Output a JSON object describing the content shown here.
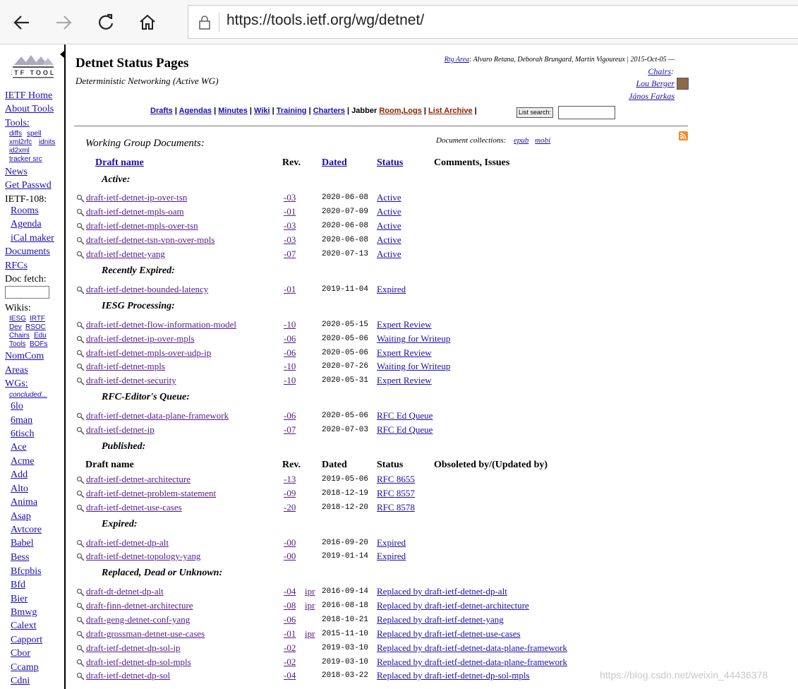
{
  "browser": {
    "url": "https://tools.ietf.org/wg/detnet/"
  },
  "sidebar": {
    "logo_text": "IETF TOOLS",
    "links_top": [
      "IETF Home",
      "About Tools"
    ],
    "tools_label": "Tools:",
    "tools_sub": [
      "diffs",
      "spell",
      "xml2rfc",
      "idnits",
      "id2xml",
      "tracker src"
    ],
    "news": "News",
    "get_passwd": "Get Passwd",
    "meeting_label": "IETF-108:",
    "meeting_links": [
      "Rooms",
      "Agenda",
      "iCal maker"
    ],
    "documents": "Documents",
    "rfcs": "RFCs",
    "doc_fetch_label": "Doc fetch:",
    "wikis_label": "Wikis:",
    "wiki_sub": [
      "IESG",
      "IRTF",
      "Dev",
      "RSOC",
      "Chairs",
      "Edu",
      "Tools",
      "BOFs"
    ],
    "nomcom": "NomCom",
    "areas": "Areas",
    "wgs_label": "WGs:",
    "concluded": "concluded...",
    "wgs": [
      "6lo",
      "6man",
      "6tisch",
      "Ace",
      "Acme",
      "Add",
      "Alto",
      "Anima",
      "Asap",
      "Avtcore",
      "Babel",
      "Bess",
      "Bfcpbis",
      "Bfd",
      "Bier",
      "Bmwg",
      "Calext",
      "Capport",
      "Cbor",
      "Ccamp",
      "Cdni"
    ]
  },
  "header": {
    "title": "Detnet Status Pages",
    "subtitle": "Deterministic Networking (Active WG)",
    "rtg_area": "Rtg Area",
    "ads": ": Alvaro Retana, Deborah Brungard, Martin Vigoureux | 2015-Oct-05 —",
    "chairs_label": "Chairs",
    "chairs": [
      "Lou Berger",
      "János Farkas"
    ]
  },
  "menu": {
    "items": [
      "Drafts",
      "Agendas",
      "Minutes",
      "Wiki",
      "Training",
      "Charters"
    ],
    "jabber": "Jabber",
    "room": "Room",
    "logs": "Logs",
    "list_archive": "List Archive",
    "list_search_button": "List search:",
    "list_search_value": ""
  },
  "documents": {
    "heading": "Working Group Documents:",
    "collections_label": "Document collections:",
    "collections": [
      "epub",
      "mobi"
    ],
    "columns": {
      "name": "Draft name",
      "rev": "Rev.",
      "dated": "Dated",
      "status": "Status",
      "comments": "Comments, Issues"
    },
    "published_columns": {
      "name": "Draft name",
      "rev": "Rev.",
      "dated": "Dated",
      "status": "Status",
      "comments": "Obsoleted by/(Updated by)"
    },
    "sections": {
      "active": "Active:",
      "expired_recent": "Recently Expired:",
      "iesg": "IESG Processing:",
      "rfc_queue": "RFC-Editor's Queue:",
      "published": "Published:",
      "expired": "Expired:",
      "replaced": "Replaced, Dead or Unknown:"
    },
    "active": [
      {
        "name": "draft-ietf-detnet-ip-over-tsn",
        "rev": "-03",
        "date": "2020-06-08",
        "status": "Active"
      },
      {
        "name": "draft-ietf-detnet-mpls-oam",
        "rev": "-01",
        "date": "2020-07-09",
        "status": "Active"
      },
      {
        "name": "draft-ietf-detnet-mpls-over-tsn",
        "rev": "-03",
        "date": "2020-06-08",
        "status": "Active"
      },
      {
        "name": "draft-ietf-detnet-tsn-vpn-over-mpls",
        "rev": "-03",
        "date": "2020-06-08",
        "status": "Active"
      },
      {
        "name": "draft-ietf-detnet-yang",
        "rev": "-07",
        "date": "2020-07-13",
        "status": "Active"
      }
    ],
    "expired_recent": [
      {
        "name": "draft-ietf-detnet-bounded-latency",
        "rev": "-01",
        "date": "2019-11-04",
        "status": "Expired"
      }
    ],
    "iesg": [
      {
        "name": "draft-ietf-detnet-flow-information-model",
        "rev": "-10",
        "date": "2020-05-15",
        "status": "Expert Review"
      },
      {
        "name": "draft-ietf-detnet-ip-over-mpls",
        "rev": "-06",
        "date": "2020-05-06",
        "status": "Waiting for Writeup"
      },
      {
        "name": "draft-ietf-detnet-mpls-over-udp-ip",
        "rev": "-06",
        "date": "2020-05-06",
        "status": "Expert Review"
      },
      {
        "name": "draft-ietf-detnet-mpls",
        "rev": "-10",
        "date": "2020-07-26",
        "status": "Waiting for Writeup"
      },
      {
        "name": "draft-ietf-detnet-security",
        "rev": "-10",
        "date": "2020-05-31",
        "status": "Expert Review"
      }
    ],
    "rfc_queue": [
      {
        "name": "draft-ietf-detnet-data-plane-framework",
        "rev": "-06",
        "date": "2020-05-06",
        "status": "RFC Ed Queue"
      },
      {
        "name": "draft-ietf-detnet-ip",
        "rev": "-07",
        "date": "2020-07-03",
        "status": "RFC Ed Queue"
      }
    ],
    "published": [
      {
        "name": "draft-ietf-detnet-architecture",
        "rev": "-13",
        "date": "2019-05-06",
        "status": "RFC 8655"
      },
      {
        "name": "draft-ietf-detnet-problem-statement",
        "rev": "-09",
        "date": "2018-12-19",
        "status": "RFC 8557"
      },
      {
        "name": "draft-ietf-detnet-use-cases",
        "rev": "-20",
        "date": "2018-12-20",
        "status": "RFC 8578"
      }
    ],
    "expired": [
      {
        "name": "draft-ietf-detnet-dp-alt",
        "rev": "-00",
        "date": "2016-09-20",
        "status": "Expired"
      },
      {
        "name": "draft-ietf-detnet-topology-yang",
        "rev": "-00",
        "date": "2019-01-14",
        "status": "Expired"
      }
    ],
    "replaced": [
      {
        "name": "draft-dt-detnet-dp-alt",
        "rev": "-04",
        "ipr": "ipr",
        "date": "2016-09-14",
        "status": "Replaced by draft-ietf-detnet-dp-alt"
      },
      {
        "name": "draft-finn-detnet-architecture",
        "rev": "-08",
        "ipr": "ipr",
        "date": "2016-08-18",
        "status": "Replaced by draft-ietf-detnet-architecture"
      },
      {
        "name": "draft-geng-detnet-conf-yang",
        "rev": "-06",
        "ipr": "",
        "date": "2018-10-21",
        "status": "Replaced by draft-ietf-detnet-yang"
      },
      {
        "name": "draft-grossman-detnet-use-cases",
        "rev": "-01",
        "ipr": "ipr",
        "date": "2015-11-10",
        "status": "Replaced by draft-ietf-detnet-use-cases"
      },
      {
        "name": "draft-ietf-detnet-dp-sol-ip",
        "rev": "-02",
        "ipr": "",
        "date": "2019-03-10",
        "status": "Replaced by draft-ietf-detnet-data-plane-framework"
      },
      {
        "name": "draft-ietf-detnet-dp-sol-mpls",
        "rev": "-02",
        "ipr": "",
        "date": "2019-03-10",
        "status": "Replaced by draft-ietf-detnet-data-plane-framework"
      },
      {
        "name": "draft-ietf-detnet-dp-sol",
        "rev": "-04",
        "ipr": "",
        "date": "2018-03-22",
        "status": "Replaced by draft-ietf-detnet-dp-sol-mpls"
      }
    ]
  },
  "watermark": "https://blog.csdn.net/weixin_44436378"
}
